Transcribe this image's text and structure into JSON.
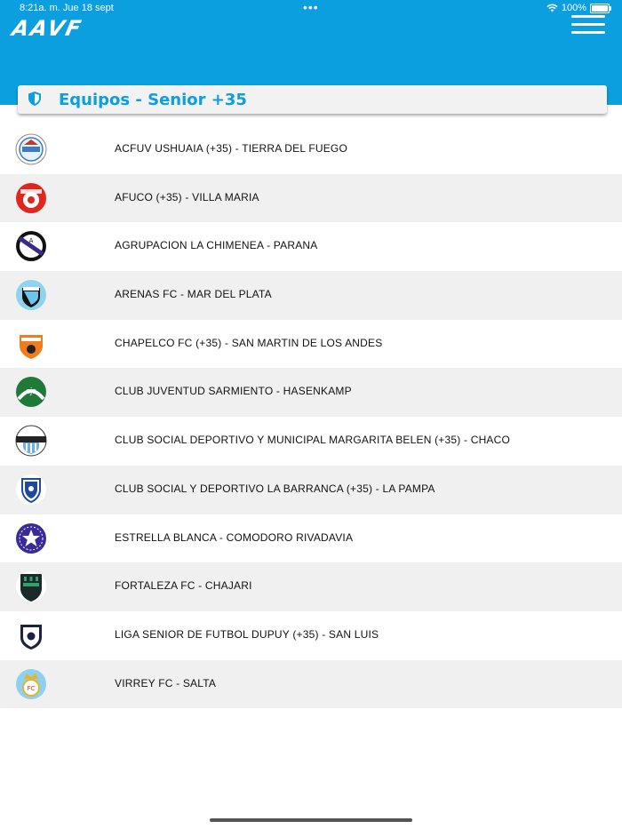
{
  "status_bar": {
    "time": "8:21a. m.   Jue 18 sept",
    "dots": "•••",
    "battery": "100%"
  },
  "header": {
    "logo": "AAVF",
    "menu_icon": "hamburger-menu-icon"
  },
  "title_card": {
    "icon": "shield-icon",
    "title": "Equipos - Senior +35"
  },
  "colors": {
    "brand_blue": "#0b9fe0",
    "row_alt": "#f0f0f0"
  },
  "teams": [
    {
      "name": "ACFUV USHUAIA (+35) - TIERRA DEL FUEGO",
      "logo": "acfuv-logo"
    },
    {
      "name": "AFUCO (+35) - VILLA MARIA",
      "logo": "afuco-logo"
    },
    {
      "name": "AGRUPACION LA CHIMENEA - PARANA",
      "logo": "chimenea-logo"
    },
    {
      "name": "ARENAS FC - MAR DEL PLATA",
      "logo": "arenas-logo"
    },
    {
      "name": "CHAPELCO FC (+35) - SAN MARTIN DE LOS ANDES",
      "logo": "chapelco-logo"
    },
    {
      "name": "CLUB JUVENTUD SARMIENTO - HASENKAMP",
      "logo": "juventud-sarmiento-logo"
    },
    {
      "name": "CLUB SOCIAL DEPORTIVO Y MUNICIPAL MARGARITA BELEN (+35) - CHACO",
      "logo": "csdmmb-logo"
    },
    {
      "name": "CLUB SOCIAL Y DEPORTIVO LA BARRANCA (+35) - LA PAMPA",
      "logo": "la-barranca-logo"
    },
    {
      "name": "ESTRELLA BLANCA - COMODORO RIVADAVIA",
      "logo": "estrella-blanca-logo"
    },
    {
      "name": "FORTALEZA FC - CHAJARI",
      "logo": "fortaleza-logo"
    },
    {
      "name": "LIGA SENIOR DE FUTBOL DUPUY (+35) - SAN LUIS",
      "logo": "dupuy-logo"
    },
    {
      "name": "VIRREY FC - SALTA",
      "logo": "virrey-logo"
    }
  ]
}
